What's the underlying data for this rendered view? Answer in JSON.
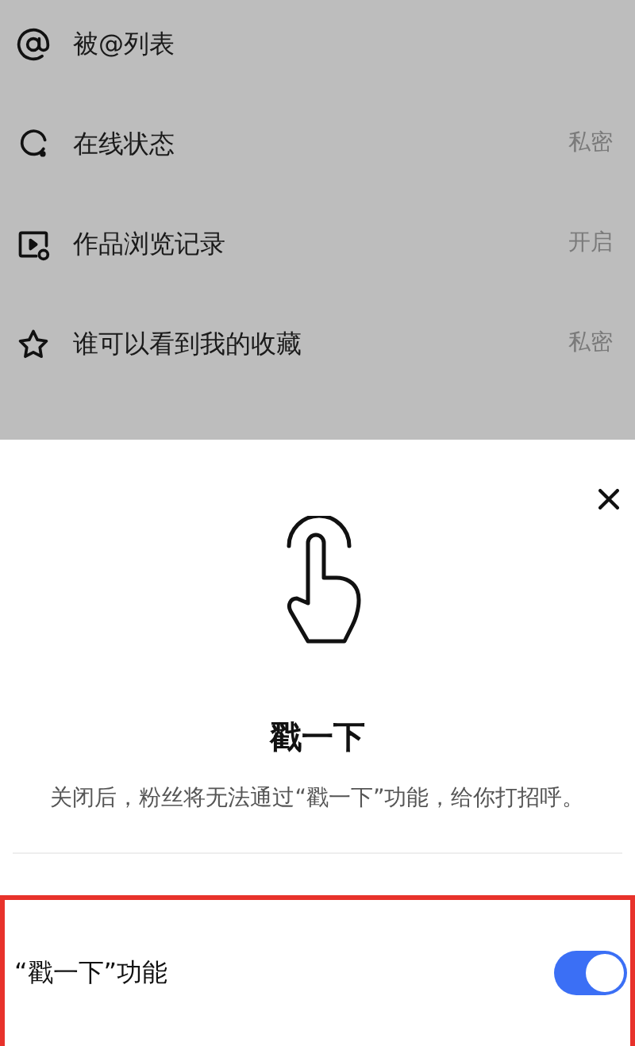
{
  "settings_list": [
    {
      "label": "被@列表"
    },
    {
      "label": "在线状态",
      "value": "私密"
    },
    {
      "label": "作品浏览记录",
      "value": "开启"
    },
    {
      "label": "谁可以看到我的收藏",
      "value": "私密"
    }
  ],
  "sheet": {
    "title": "戳一下",
    "description": "关闭后，粉丝将无法通过“戳一下”功能，给你打招呼。",
    "toggle": {
      "label": "“戳一下”功能",
      "on": true,
      "highlighted": true
    }
  }
}
